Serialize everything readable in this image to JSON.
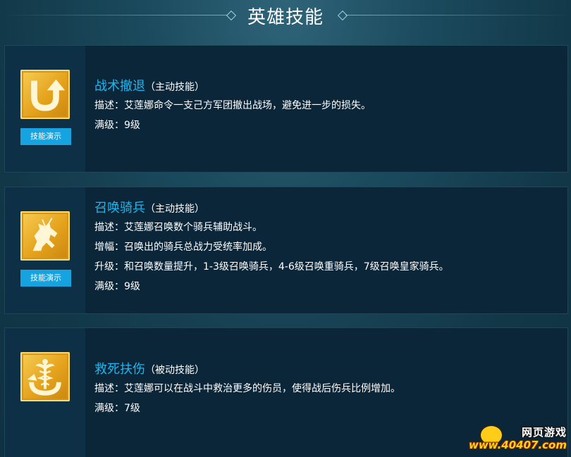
{
  "header": {
    "title": "英雄技能"
  },
  "skills": [
    {
      "name": "战术撤退",
      "type": "（主动技能）",
      "icon": "u-turn-arrow-icon",
      "demo_label": "技能演示",
      "lines": [
        "描述：艾莲娜命令一支己方军团撤出战场，避免进一步的损失。",
        "满级：9级"
      ]
    },
    {
      "name": "召唤骑兵",
      "type": "（主动技能）",
      "icon": "horse-icon",
      "demo_label": "技能演示",
      "lines": [
        "描述：艾莲娜召唤数个骑兵辅助战斗。",
        "增幅：召唤出的骑兵总战力受统率加成。",
        "升级：和召唤数量提升，1-3级召唤骑兵，4-6级召唤重骑兵，7级召唤皇家骑兵。",
        "满级：9级"
      ]
    },
    {
      "name": "救死扶伤",
      "type": "（被动技能）",
      "icon": "caduceus-icon",
      "lines": [
        "描述：艾莲娜可以在战斗中救治更多的伤员，使得战后伤兵比例增加。",
        "满级：7级"
      ]
    }
  ],
  "watermark": {
    "top": "网页游戏",
    "bottom": "www.40407.com"
  },
  "colors": {
    "accent": "#1db7f0",
    "button": "#17a3e0",
    "icon_gold": "#e5a21c",
    "card_bg": "#0b2639"
  }
}
